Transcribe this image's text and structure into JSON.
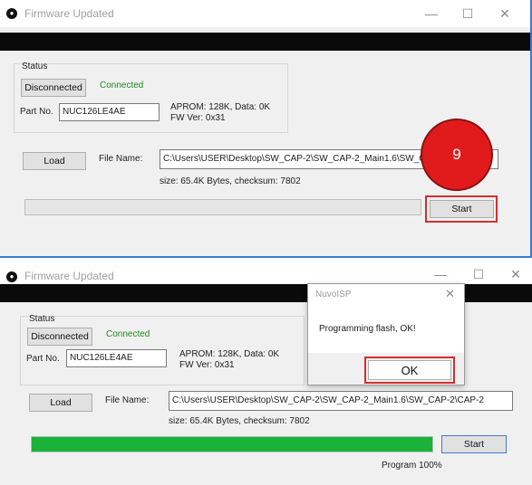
{
  "window_top": {
    "title": "Firmware Updated",
    "minimize_glyph": "—",
    "maximize_glyph": "☐",
    "close_glyph": "✕",
    "status_label": "Status",
    "disconnected_button": "Disconnected",
    "connection_status": "Connected",
    "part_no_label": "Part No.",
    "part_no_value": "NUC126LE4AE",
    "aprom_info": "APROM: 128K, Data: 0K",
    "fw_ver": "FW Ver: 0x31",
    "load_button": "Load",
    "file_name_label": "File Name:",
    "file_path": "C:\\Users\\USER\\Desktop\\SW_CAP-2\\SW_CAP-2_Main1.6\\SW_CAP-2\\CAP-2",
    "file_info": "size: 65.4K Bytes, checksum: 7802",
    "progress_fraction": 0,
    "start_button": "Start",
    "step_badge": "9"
  },
  "window_bottom": {
    "title": "Firmware Updated",
    "minimize_glyph": "—",
    "maximize_glyph": "☐",
    "close_glyph": "✕",
    "status_label": "Status",
    "disconnected_button": "Disconnected",
    "connection_status": "Connected",
    "part_no_label": "Part No.",
    "part_no_value": "NUC126LE4AE",
    "aprom_info": "APROM: 128K, Data: 0K",
    "fw_ver": "FW Ver: 0x31",
    "load_button": "Load",
    "file_name_label": "File Name:",
    "file_path": "C:\\Users\\USER\\Desktop\\SW_CAP-2\\SW_CAP-2_Main1.6\\SW_CAP-2\\CAP-2",
    "file_info": "size: 65.4K Bytes, checksum: 7802",
    "progress_fraction": 1.0,
    "start_button": "Start",
    "progress_text": "Program 100%"
  },
  "dialog": {
    "title": "NuvoISP",
    "close_glyph": "✕",
    "message": "Programming flash, OK!",
    "ok_button": "OK"
  },
  "colors": {
    "accent_border": "#3a7bd5",
    "connected_text": "#1f8a1f",
    "progress_green": "#19b33a",
    "highlight_red": "#d32f2f",
    "badge_red": "#e11b1b"
  }
}
